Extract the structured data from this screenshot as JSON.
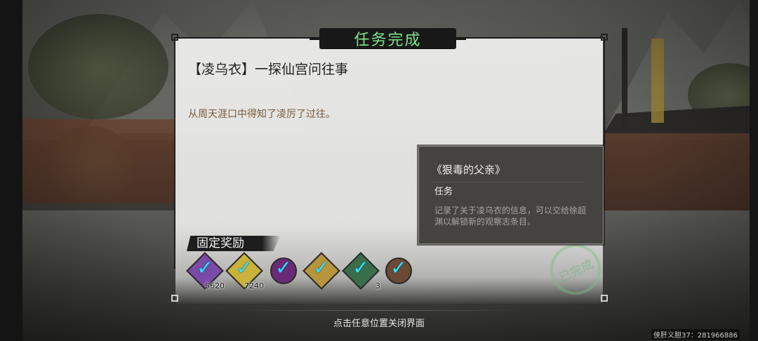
{
  "header": {
    "title": "任务完成"
  },
  "quest": {
    "name": "【凌乌衣】一探仙宫问往事",
    "description": "从周天涯口中得知了凌厉了过往。"
  },
  "rewards": {
    "header": "固定奖励",
    "items": [
      {
        "icon": "purple-check-icon",
        "count": "5620",
        "color": "#7a4aa8"
      },
      {
        "icon": "gold-coin-check-icon",
        "count": "7240",
        "color": "#c9b23a"
      },
      {
        "icon": "purple-mask-check-icon",
        "count": "",
        "color": "#6a2a78"
      },
      {
        "icon": "gold-scroll-check-icon",
        "count": "",
        "color": "#b8953a"
      },
      {
        "icon": "green-tablets-check-icon",
        "count": "3",
        "color": "#3a6e4a"
      },
      {
        "icon": "bronze-item-check-icon",
        "count": "",
        "color": "#6a4a35"
      }
    ]
  },
  "stamp": {
    "text": "已完成"
  },
  "tooltip": {
    "title": "《狠毒的父亲》",
    "type": "任务",
    "description": "记录了关于凌乌衣的信息，可以交给徐超渊以解锁新的观察志条目。"
  },
  "footer": {
    "hint": "点击任意位置关闭界面"
  },
  "watermark": "侠肝义胆37：281966886"
}
